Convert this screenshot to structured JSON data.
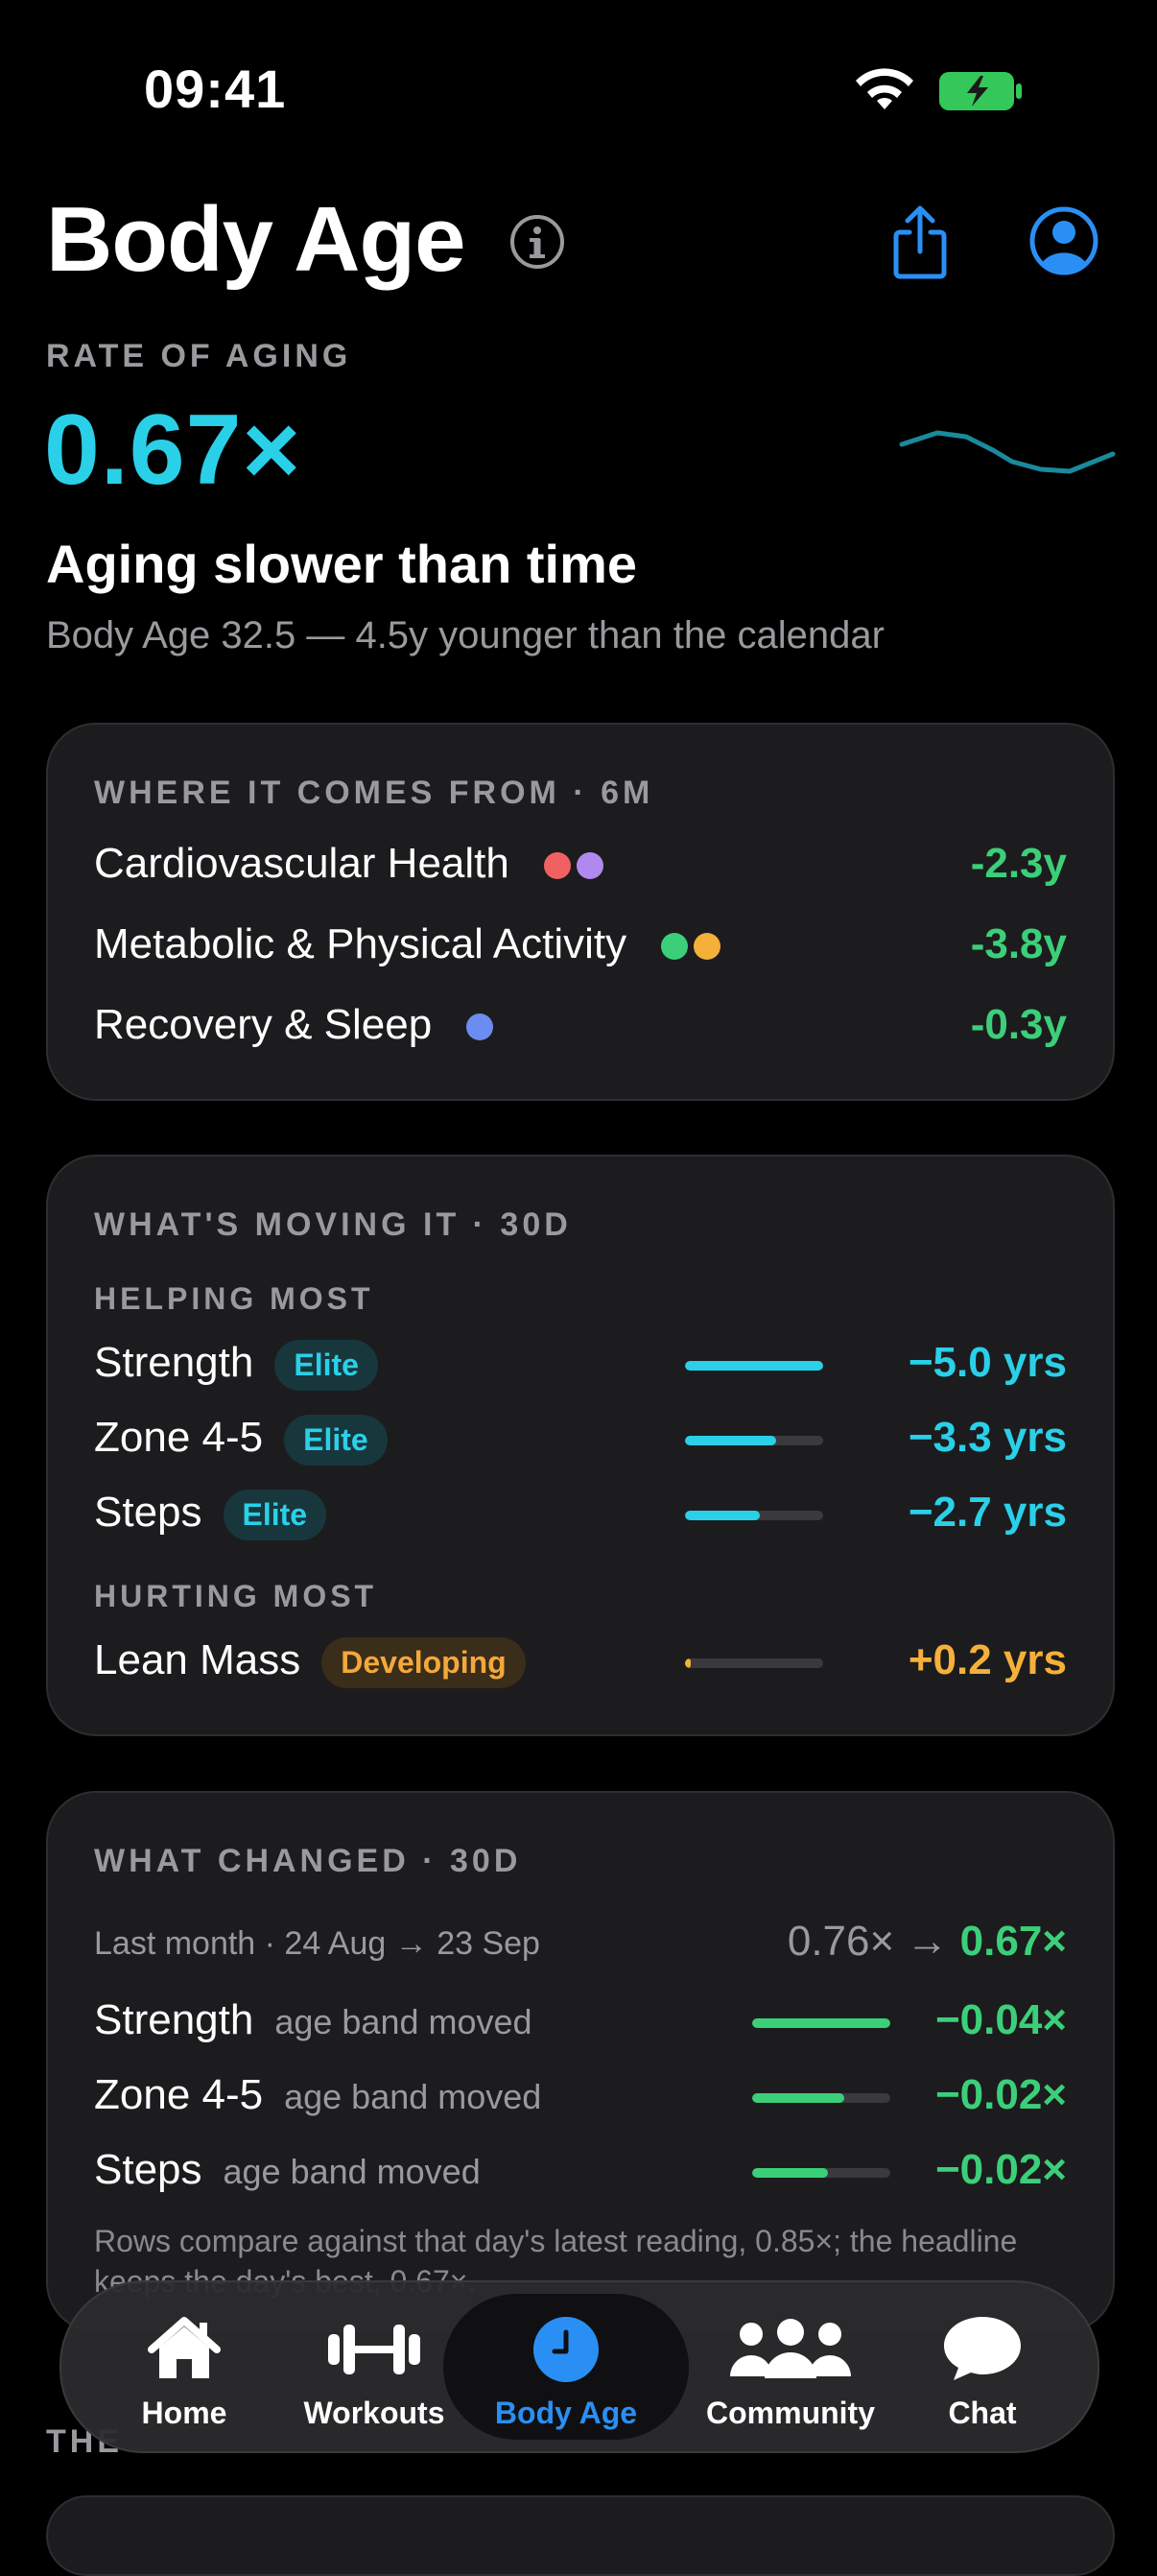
{
  "status": {
    "time": "09:41"
  },
  "header": {
    "title": "Body Age"
  },
  "rate": {
    "label": "RATE OF AGING",
    "value": "0.67×",
    "headline": "Aging slower than time",
    "description": "Body Age 32.5 — 4.5y younger than the calendar",
    "trend_color": "#1a8a9c"
  },
  "comes_from": {
    "label": "WHERE IT COMES FROM · 6M",
    "rows": [
      {
        "name": "Cardiovascular Health",
        "value": "-2.3y",
        "dots": [
          "#f06262",
          "#b089f0"
        ]
      },
      {
        "name": "Metabolic & Physical Activity",
        "value": "-3.8y",
        "dots": [
          "#3ccf7a",
          "#f5b03a"
        ]
      },
      {
        "name": "Recovery & Sleep",
        "value": "-0.3y",
        "dots": [
          "#6b8cf0"
        ]
      }
    ]
  },
  "moving": {
    "label": "WHAT'S MOVING IT · 30D",
    "helping_label": "HELPING MOST",
    "hurting_label": "HURTING MOST",
    "helping": [
      {
        "name": "Strength",
        "badge": "Elite",
        "value": "−5.0 yrs",
        "fill": 1.0
      },
      {
        "name": "Zone 4-5",
        "badge": "Elite",
        "value": "−3.3 yrs",
        "fill": 0.66
      },
      {
        "name": "Steps",
        "badge": "Elite",
        "value": "−2.7 yrs",
        "fill": 0.54
      }
    ],
    "hurting": [
      {
        "name": "Lean Mass",
        "badge": "Developing",
        "value": "+0.2 yrs",
        "fill": 0.04
      }
    ]
  },
  "changed": {
    "label": "WHAT CHANGED · 30D",
    "period": "Last month · 24 Aug → 23 Sep",
    "from": "0.76× →",
    "to": "0.67×",
    "rows": [
      {
        "name": "Strength",
        "desc": "age band moved",
        "value": "−0.04×",
        "fill": 1.0
      },
      {
        "name": "Zone 4-5",
        "desc": "age band moved",
        "value": "−0.02×",
        "fill": 0.67
      },
      {
        "name": "Steps",
        "desc": "age band moved",
        "value": "−0.02×",
        "fill": 0.55
      }
    ],
    "footnote": "Rows compare against that day's latest reading, 0.85×; the headline keeps the day's best, 0.67×."
  },
  "peek": {
    "label": "THE"
  },
  "tabs": [
    {
      "label": "Home",
      "icon": "home-icon"
    },
    {
      "label": "Workouts",
      "icon": "dumbbell-icon"
    },
    {
      "label": "Body Age",
      "icon": "clock-icon",
      "active": true
    },
    {
      "label": "Community",
      "icon": "people-icon"
    },
    {
      "label": "Chat",
      "icon": "chat-bubble-icon"
    }
  ],
  "colors": {
    "cyan": "#2ad0e8",
    "green": "#3ccf7a",
    "orange": "#f5b03a",
    "blue": "#2a8ff5"
  }
}
